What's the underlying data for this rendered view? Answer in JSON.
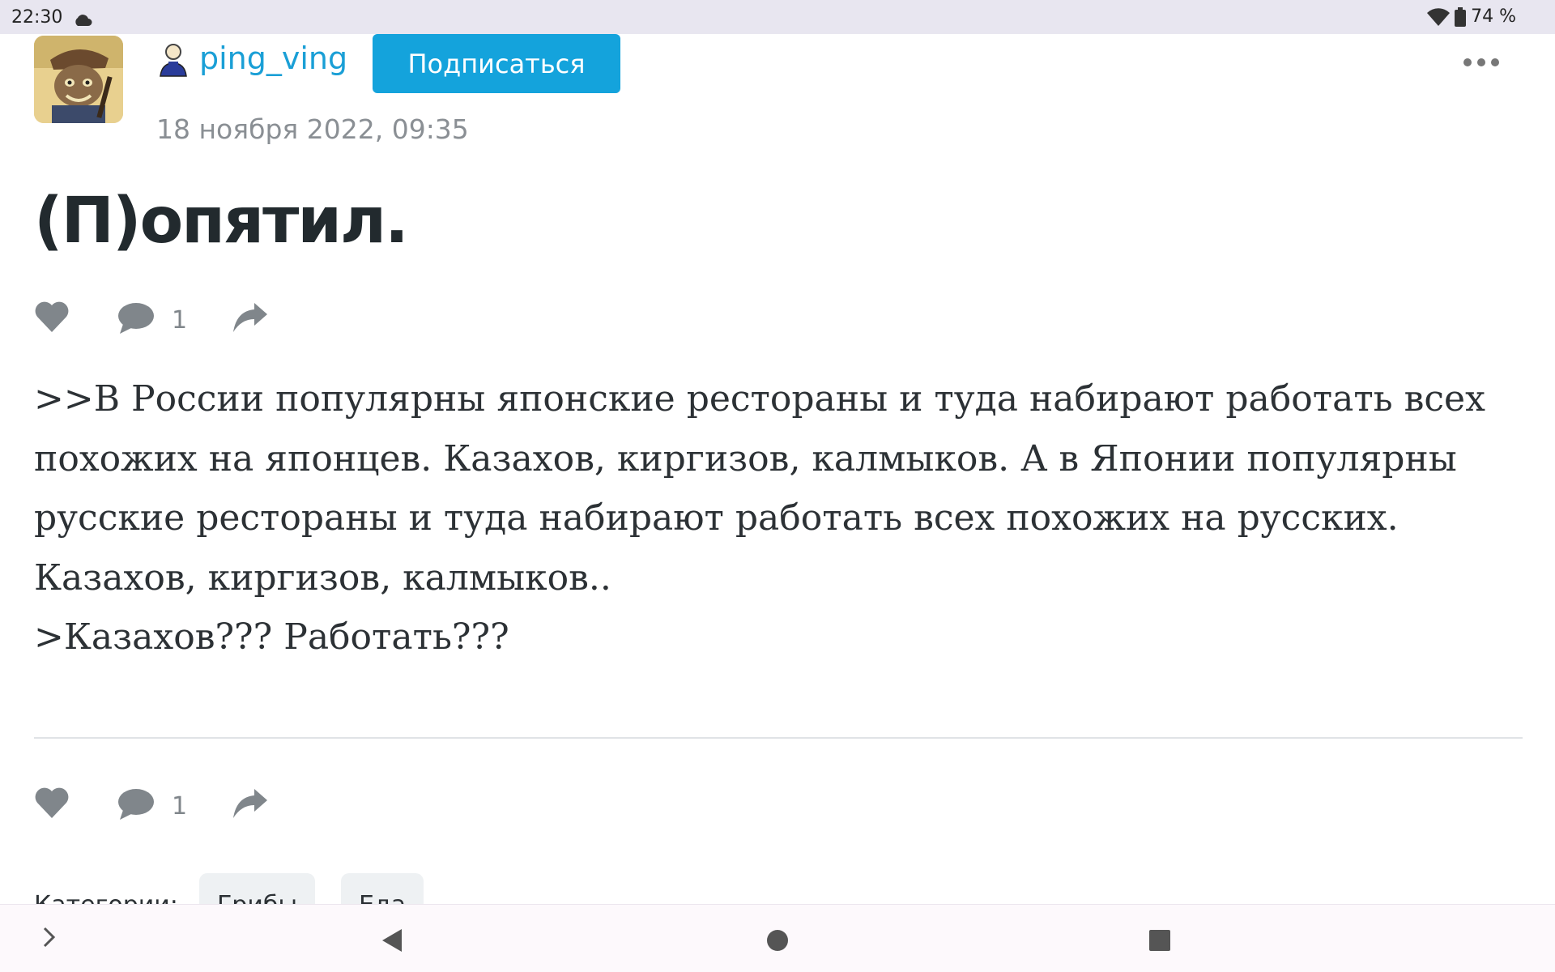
{
  "status_bar": {
    "time": "22:30",
    "cloud_icon": "cloud-icon",
    "wifi_icon": "wifi-icon",
    "battery_icon": "battery-icon",
    "battery_level": "74 %"
  },
  "post": {
    "author": {
      "avatar_icon": "cat-avatar",
      "user_icon": "user-icon",
      "name": "ping_ving"
    },
    "subscribe_label": "Подписаться",
    "more_icon": "more-icon",
    "date": "18 ноября 2022, 09:35",
    "title": "(П)опятил.",
    "body": [
      ">>В России популярны японские рестораны и туда набирают работать всех похожих на японцев. Казахов, киргизов, калмыков. А в Японии популярны русские рестораны и туда набирают работать всех похожих на русских. Казахов, киргизов, калмыков..",
      ">Казахов??? Работать???"
    ],
    "actions_top": {
      "comment_count": "1"
    },
    "actions_bottom": {
      "comment_count": "1"
    },
    "categories": {
      "label": "Категории:",
      "tags": [
        "Грибы",
        "Еда"
      ]
    }
  },
  "nav_bar": {
    "icons": [
      "chevron-right-icon",
      "back-icon",
      "home-icon",
      "recents-icon"
    ]
  }
}
